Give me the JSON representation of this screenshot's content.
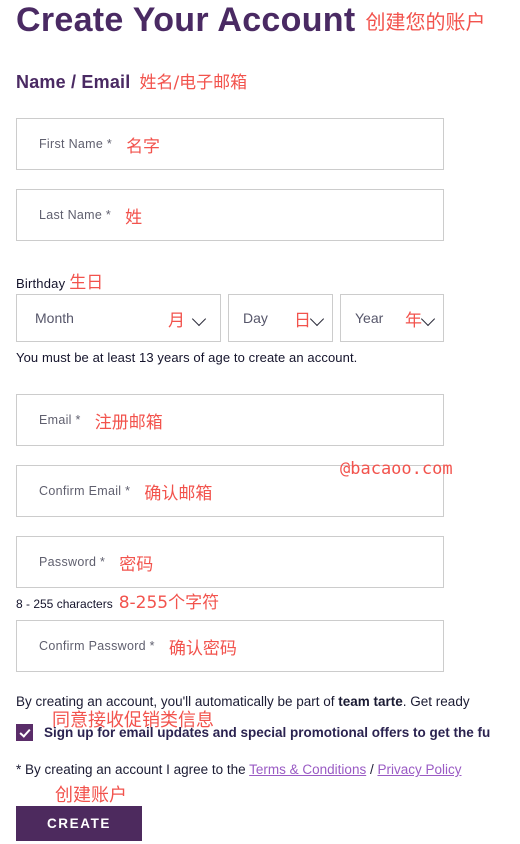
{
  "page": {
    "title": "Create Your Account",
    "title_annotation": "创建您的账户",
    "watermark": "@bacaoo.com",
    "colors": {
      "brand_purple": "#4a2a63",
      "button_purple": "#4d2a5e",
      "checkbox_purple": "#5a2d69",
      "link_purple": "#9a5bc4",
      "annotation_red": "#f2534d",
      "input_border": "#cccccc",
      "body_text": "#1b1b33"
    }
  },
  "section": {
    "heading": "Name / Email",
    "heading_annotation": "姓名/电子邮箱"
  },
  "fields": {
    "first_name": {
      "label": "First Name *",
      "annotation": "名字",
      "value": ""
    },
    "last_name": {
      "label": "Last Name *",
      "annotation": "姓",
      "value": ""
    },
    "email": {
      "label": "Email *",
      "annotation": "注册邮箱",
      "value": ""
    },
    "confirm_email": {
      "label": "Confirm Email *",
      "annotation": "确认邮箱",
      "value": ""
    },
    "password": {
      "label": "Password *",
      "annotation": "密码",
      "value": ""
    },
    "confirm_password": {
      "label": "Confirm Password *",
      "annotation": "确认密码",
      "value": ""
    }
  },
  "birthday": {
    "label": "Birthday",
    "annotation": "生日",
    "month": {
      "selected": "Month",
      "annotation": "月"
    },
    "day": {
      "selected": "Day",
      "annotation": "日"
    },
    "year": {
      "selected": "Year",
      "annotation": "年"
    },
    "age_note": "You must be at least 13 years of age to create an account."
  },
  "password_note": {
    "text": "8 - 255 characters",
    "annotation": "8-255个字符"
  },
  "legal": {
    "team_line_pre": "By creating an account, you'll automatically be part of ",
    "team_line_bold": "team tarte",
    "team_line_post": ". Get ready",
    "signup_checkbox_label": "Sign up for email updates and special promotional offers to get the fu",
    "signup_annotation": "同意接收促销类信息",
    "signup_checked": true,
    "terms_prefix": "* By creating an account I agree to the ",
    "terms_link": "Terms & Conditions",
    "terms_separator": " / ",
    "privacy_link": "Privacy Policy"
  },
  "submit": {
    "label": "CREATE",
    "annotation": "创建账户"
  }
}
